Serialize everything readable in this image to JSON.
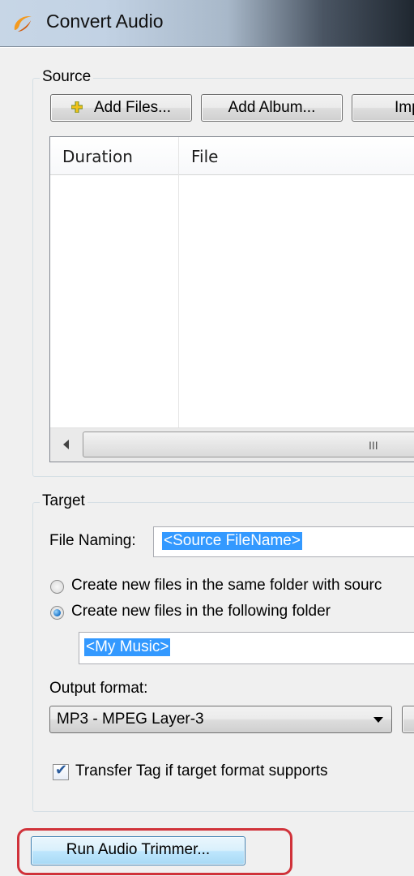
{
  "window": {
    "title": "Convert Audio",
    "app_icon": "app-logo-icon"
  },
  "source": {
    "group_label": "Source",
    "buttons": {
      "add_files": "Add Files...",
      "add_files_icon": "plus-icon",
      "add_album": "Add Album...",
      "import": "Imp"
    },
    "table": {
      "columns": [
        "Duration",
        "File"
      ],
      "rows": []
    },
    "scrollbar_grip": "III"
  },
  "target": {
    "group_label": "Target",
    "file_naming_label": "File Naming:",
    "file_naming_value": "<Source FileName>",
    "radio_same_folder": "Create new files in the same folder with sourc",
    "radio_following_folder": "Create new files in the following folder",
    "selected_radio": "following_folder",
    "folder_value": "<My Music>",
    "output_format_label": "Output format:",
    "output_format_value": "MP3 - MPEG Layer-3",
    "transfer_tag_label": "Transfer Tag if target format supports",
    "transfer_tag_checked": true
  },
  "footer": {
    "run_trimmer_label": "Run Audio Trimmer...",
    "highlight_color": "#d0323a"
  }
}
